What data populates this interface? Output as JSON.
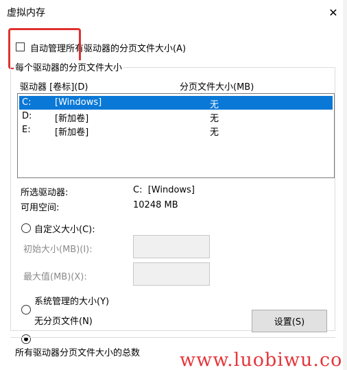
{
  "window": {
    "title": "虚拟内存",
    "close_glyph": "✕"
  },
  "auto_manage": {
    "label": "自动管理所有驱动器的分页文件大小(A)",
    "checked": false
  },
  "group": {
    "legend": "每个驱动器的分页文件大小",
    "columns": {
      "drive": "驱动器 [卷标](D)",
      "size": "分页文件大小(MB)"
    },
    "rows": [
      {
        "drive": "C:",
        "label": "[Windows]",
        "size": "无",
        "selected": true
      },
      {
        "drive": "D:",
        "label": "[新加卷]",
        "size": "无",
        "selected": false
      },
      {
        "drive": "E:",
        "label": "[新加卷]",
        "size": "无",
        "selected": false
      }
    ],
    "selected_drive_label": "所选驱动器:",
    "selected_drive_value": "C:  [Windows]",
    "free_space_label": "可用空间:",
    "free_space_value": "10248 MB",
    "custom_size_label": "自定义大小(C):",
    "initial_size_label": "初始大小(MB)(I):",
    "max_size_label": "最大值(MB)(X):",
    "system_managed_label": "系统管理的大小(Y)",
    "no_paging_label": "无分页文件(N)",
    "selected_option": "no_paging",
    "set_button": "设置(S)"
  },
  "total": {
    "legend": "所有驱动器分页文件大小的总数"
  },
  "watermark": {
    "text": "www.luobiwu.com"
  },
  "colors": {
    "selection": "#0a78d7",
    "highlight": "#e0312e",
    "watermark": "#e4363c"
  }
}
